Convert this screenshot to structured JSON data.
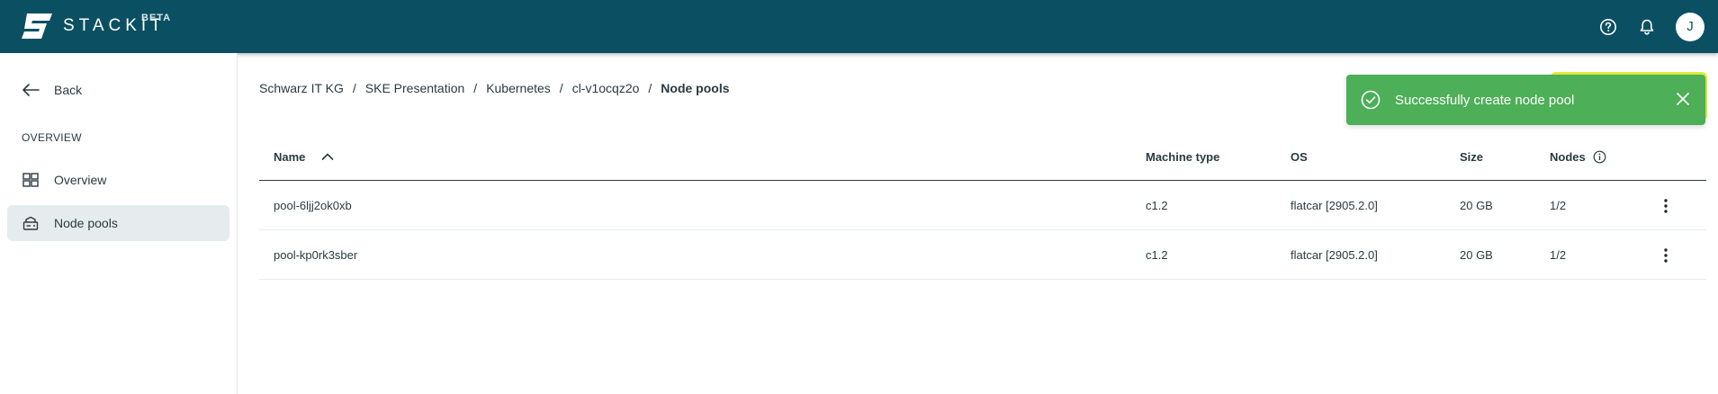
{
  "header": {
    "brand": "STACKIT",
    "badge": "BETA",
    "avatar_initial": "J",
    "icons": [
      "help-icon",
      "bell-icon"
    ],
    "colors": {
      "bar": "#0b5062"
    }
  },
  "sidebar": {
    "back_label": "Back",
    "section_title": "OVERVIEW",
    "items": [
      {
        "label": "Overview",
        "icon": "grid-icon",
        "active": false
      },
      {
        "label": "Node pools",
        "icon": "node-pool-icon",
        "active": true
      }
    ]
  },
  "breadcrumb": {
    "items": [
      "Schwarz IT KG",
      "SKE Presentation",
      "Kubernetes",
      "cl-v1ocqz2o"
    ],
    "current": "Node pools",
    "separator": "/"
  },
  "table": {
    "columns": {
      "name": "Name",
      "machine_type": "Machine type",
      "os": "OS",
      "size": "Size",
      "nodes": "Nodes"
    },
    "sort": {
      "column": "name",
      "direction": "ascending"
    },
    "rows": [
      {
        "name": "pool-6ljj2ok0xb",
        "machine_type": "c1.2",
        "os": "flatcar [2905.2.0]",
        "size": "20 GB",
        "nodes": "1/2"
      },
      {
        "name": "pool-kp0rk3sber",
        "machine_type": "c1.2",
        "os": "flatcar [2905.2.0]",
        "size": "20 GB",
        "nodes": "1/2"
      }
    ]
  },
  "toast": {
    "message": "Successfully create node pool",
    "color": "#4daf57"
  }
}
